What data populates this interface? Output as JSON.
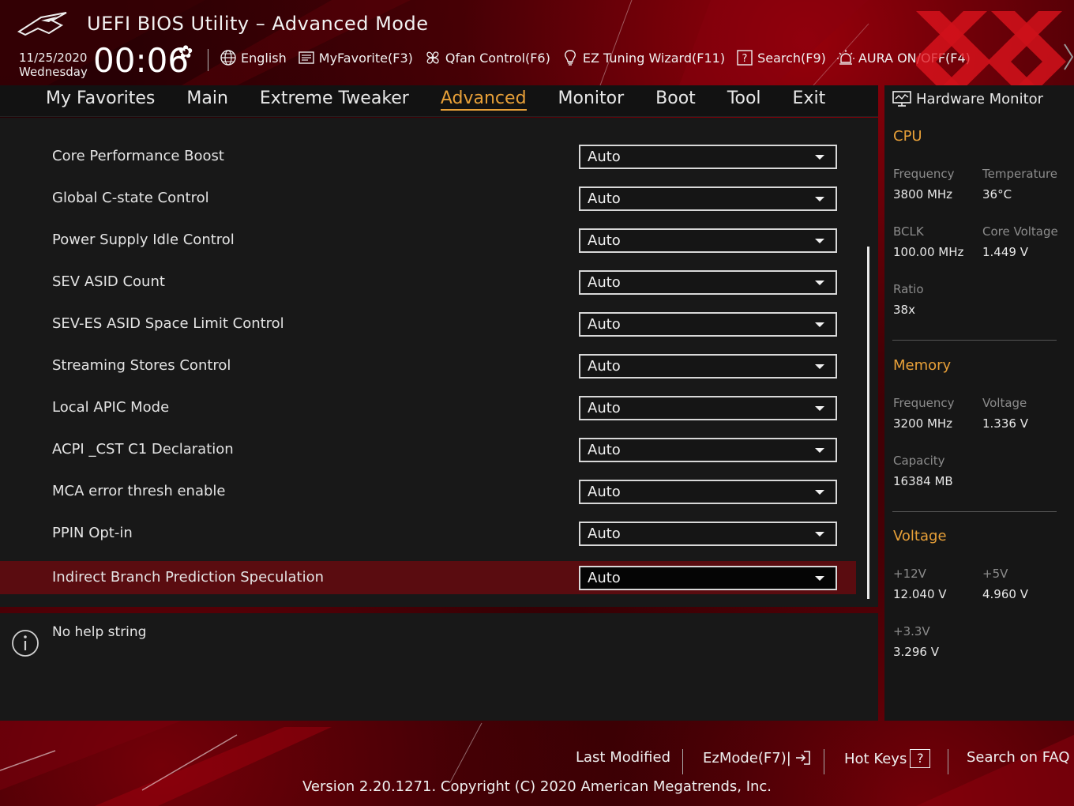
{
  "header": {
    "title": "UEFI BIOS Utility – Advanced Mode",
    "date": "11/25/2020",
    "weekday": "Wednesday",
    "time": "00:06",
    "tools": [
      {
        "label": "English",
        "icon": "globe-icon"
      },
      {
        "label": "MyFavorite(F3)",
        "icon": "favorite-list-icon"
      },
      {
        "label": "Qfan Control(F6)",
        "icon": "fan-icon"
      },
      {
        "label": "EZ Tuning Wizard(F11)",
        "icon": "lightbulb-icon"
      },
      {
        "label": "Search(F9)",
        "icon": "search-help-icon"
      },
      {
        "label": "AURA ON/OFF(F4)",
        "icon": "aura-light-icon"
      }
    ]
  },
  "nav": {
    "tabs": [
      "My Favorites",
      "Main",
      "Extreme Tweaker",
      "Advanced",
      "Monitor",
      "Boot",
      "Tool",
      "Exit"
    ],
    "active": "Advanced"
  },
  "settings": [
    {
      "label": "Core Performance Boost",
      "value": "Auto"
    },
    {
      "label": "Global C-state Control",
      "value": "Auto"
    },
    {
      "label": "Power Supply Idle Control",
      "value": "Auto"
    },
    {
      "label": "SEV ASID Count",
      "value": "Auto"
    },
    {
      "label": "SEV-ES ASID Space Limit Control",
      "value": "Auto"
    },
    {
      "label": "Streaming Stores Control",
      "value": "Auto"
    },
    {
      "label": "Local APIC Mode",
      "value": "Auto"
    },
    {
      "label": "ACPI _CST C1 Declaration",
      "value": "Auto"
    },
    {
      "label": "MCA error thresh enable",
      "value": "Auto"
    },
    {
      "label": "PPIN Opt-in",
      "value": "Auto"
    },
    {
      "label": "Indirect Branch Prediction Speculation",
      "value": "Auto",
      "selected": true
    }
  ],
  "help": {
    "text": "No help string"
  },
  "hardware_monitor": {
    "title": "Hardware Monitor",
    "cpu": {
      "heading": "CPU",
      "frequency_label": "Frequency",
      "frequency": "3800 MHz",
      "temperature_label": "Temperature",
      "temperature": "36°C",
      "bclk_label": "BCLK",
      "bclk": "100.00 MHz",
      "core_voltage_label": "Core Voltage",
      "core_voltage": "1.449 V",
      "ratio_label": "Ratio",
      "ratio": "38x"
    },
    "memory": {
      "heading": "Memory",
      "frequency_label": "Frequency",
      "frequency": "3200 MHz",
      "voltage_label": "Voltage",
      "voltage": "1.336 V",
      "capacity_label": "Capacity",
      "capacity": "16384 MB"
    },
    "voltage": {
      "heading": "Voltage",
      "v12_label": "+12V",
      "v12": "12.040 V",
      "v5_label": "+5V",
      "v5": "4.960 V",
      "v33_label": "+3.3V",
      "v33": "3.296 V"
    }
  },
  "footer": {
    "last_modified": "Last Modified",
    "ezmode": "EzMode(F7)|",
    "hot_keys": "Hot Keys",
    "hot_keys_key": "?",
    "search_faq": "Search on FAQ",
    "version": "Version 2.20.1271. Copyright (C) 2020 American Megatrends, Inc."
  },
  "colors": {
    "accent": "#e8a038",
    "selected_row": "#5a0c10",
    "brand_red": "#b0000c"
  }
}
